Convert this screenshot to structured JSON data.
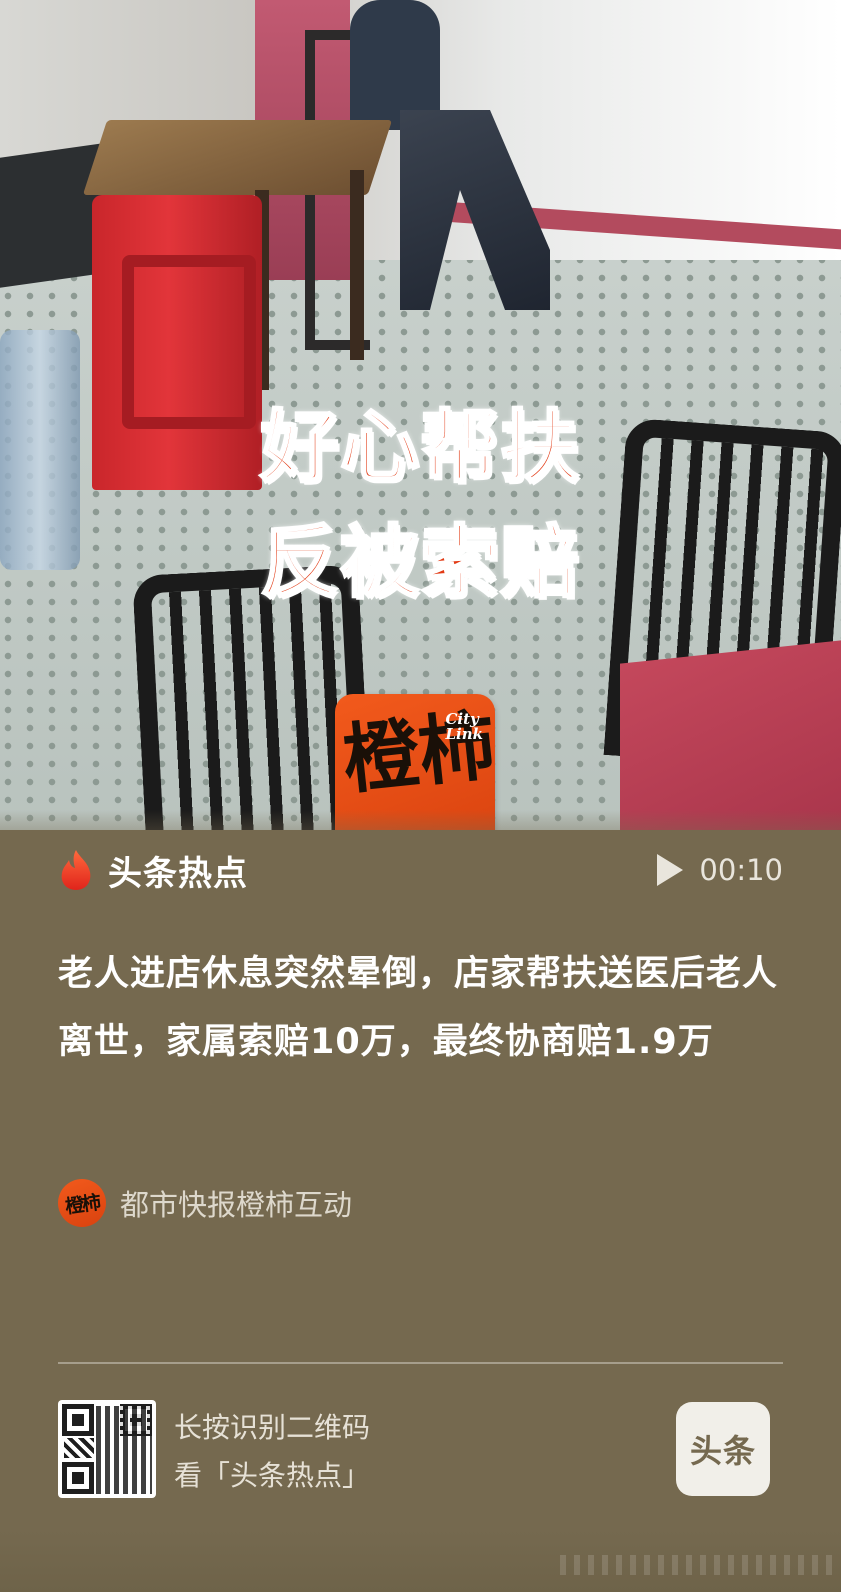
{
  "video": {
    "overlay_line1": "好心帮扶",
    "overlay_line2": "反被索赔",
    "logo_brush_text": "橙柿",
    "logo_city_text": "City",
    "logo_link_text": "Link",
    "duration": "00:10",
    "colors": {
      "overlay_text": "#e23a14",
      "logo_bg": "#f25a1c"
    }
  },
  "source": {
    "label": "头条热点",
    "icon": "flame-icon"
  },
  "headline": "老人进店休息突然晕倒，店家帮扶送医后老人离世，家属索赔10万，最终协商赔1.9万",
  "author": {
    "avatar_text": "橙柿",
    "name": "都市快报橙柿互动"
  },
  "footer": {
    "qr_line1": "长按识别二维码",
    "qr_line2": "看「头条热点」",
    "app_logo_text": "头条"
  },
  "theme": {
    "card_bg": "#75694f",
    "text_primary": "#ffffff"
  }
}
